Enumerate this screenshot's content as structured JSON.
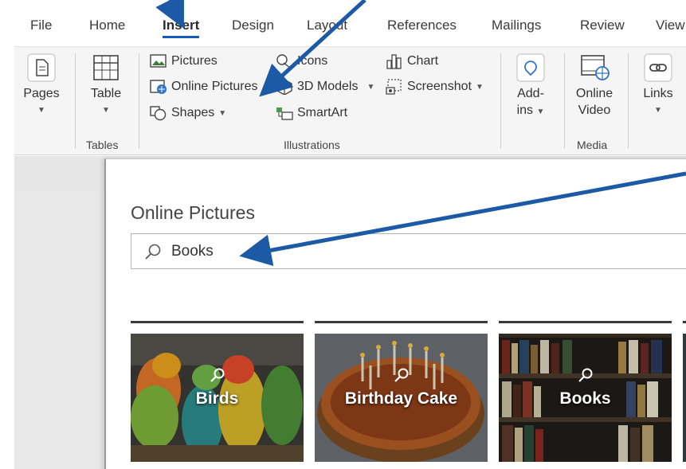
{
  "tabs": [
    {
      "label": "File"
    },
    {
      "label": "Home"
    },
    {
      "label": "Insert",
      "active": true
    },
    {
      "label": "Design"
    },
    {
      "label": "Layout"
    },
    {
      "label": "References"
    },
    {
      "label": "Mailings"
    },
    {
      "label": "Review"
    },
    {
      "label": "View"
    }
  ],
  "ribbon": {
    "pages": {
      "label": "Pages"
    },
    "tables": {
      "button": "Table",
      "group_label": "Tables"
    },
    "illustrations": {
      "pictures": "Pictures",
      "online_pictures": "Online Pictures",
      "shapes": "Shapes",
      "icons": "Icons",
      "models_3d": "3D Models",
      "smartart": "SmartArt",
      "chart": "Chart",
      "screenshot": "Screenshot",
      "group_label": "Illustrations"
    },
    "addins": {
      "line1": "Add-",
      "line2": "ins"
    },
    "media": {
      "line1": "Online",
      "line2": "Video",
      "group_label": "Media"
    },
    "links": {
      "label": "Links"
    }
  },
  "dialog": {
    "title": "Online Pictures",
    "search_value": "Books",
    "tiles": [
      {
        "label": "Birds"
      },
      {
        "label": "Birthday Cake"
      },
      {
        "label": "Books"
      }
    ]
  },
  "colors": {
    "accent": "#185abd",
    "annotation_arrow": "#1d5aa6"
  }
}
